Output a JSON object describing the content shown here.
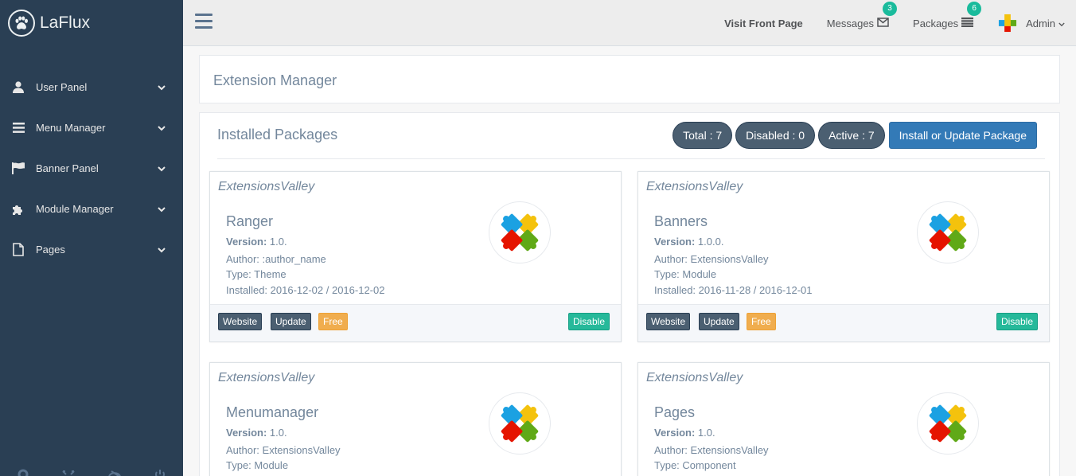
{
  "brand": {
    "name": "LaFlux",
    "logo_icon": "paw-icon"
  },
  "sidebar": {
    "items": [
      {
        "label": "User Panel",
        "icon": "user-icon"
      },
      {
        "label": "Menu Manager",
        "icon": "bars-icon"
      },
      {
        "label": "Banner Panel",
        "icon": "flag-icon"
      },
      {
        "label": "Module Manager",
        "icon": "puzzle-icon"
      },
      {
        "label": "Pages",
        "icon": "file-icon"
      }
    ],
    "footer_icons": [
      "gear-icon",
      "fullscreen-icon",
      "eye-slash-icon",
      "power-icon"
    ]
  },
  "topbar": {
    "visit_label": "Visit Front Page",
    "messages_label": "Messages",
    "messages_count": "3",
    "packages_label": "Packages",
    "packages_count": "6",
    "user_label": "Admin"
  },
  "page": {
    "title": "Extension Manager"
  },
  "installed": {
    "title": "Installed Packages",
    "total": "Total : 7",
    "disabled": "Disabled : 0",
    "active": "Active : 7",
    "install_button": "Install or Update Package"
  },
  "labels": {
    "version": "Version:",
    "website": "Website",
    "update": "Update",
    "free": "Free",
    "disable": "Disable"
  },
  "packages": [
    {
      "vendor": "ExtensionsValley",
      "name": "Ranger",
      "version": "1.0.",
      "author": "Author: :author_name",
      "type": "Type: Theme",
      "installed": "Installed: 2016-12-02 / 2016-12-02"
    },
    {
      "vendor": "ExtensionsValley",
      "name": "Banners",
      "version": "1.0.0.",
      "author": "Author: ExtensionsValley",
      "type": "Type: Module",
      "installed": "Installed: 2016-11-28 / 2016-12-01"
    },
    {
      "vendor": "ExtensionsValley",
      "name": "Menumanager",
      "version": "1.0.",
      "author": "Author: ExtensionsValley",
      "type": "Type: Module",
      "installed": ""
    },
    {
      "vendor": "ExtensionsValley",
      "name": "Pages",
      "version": "1.0.",
      "author": "Author: ExtensionsValley",
      "type": "Type: Component",
      "installed": ""
    }
  ],
  "colors": {
    "sidebar": "#2a3f54",
    "badge": "#1abb9c",
    "primary": "#337ab7",
    "success": "#26b99a",
    "warning": "#f0ad4e"
  }
}
